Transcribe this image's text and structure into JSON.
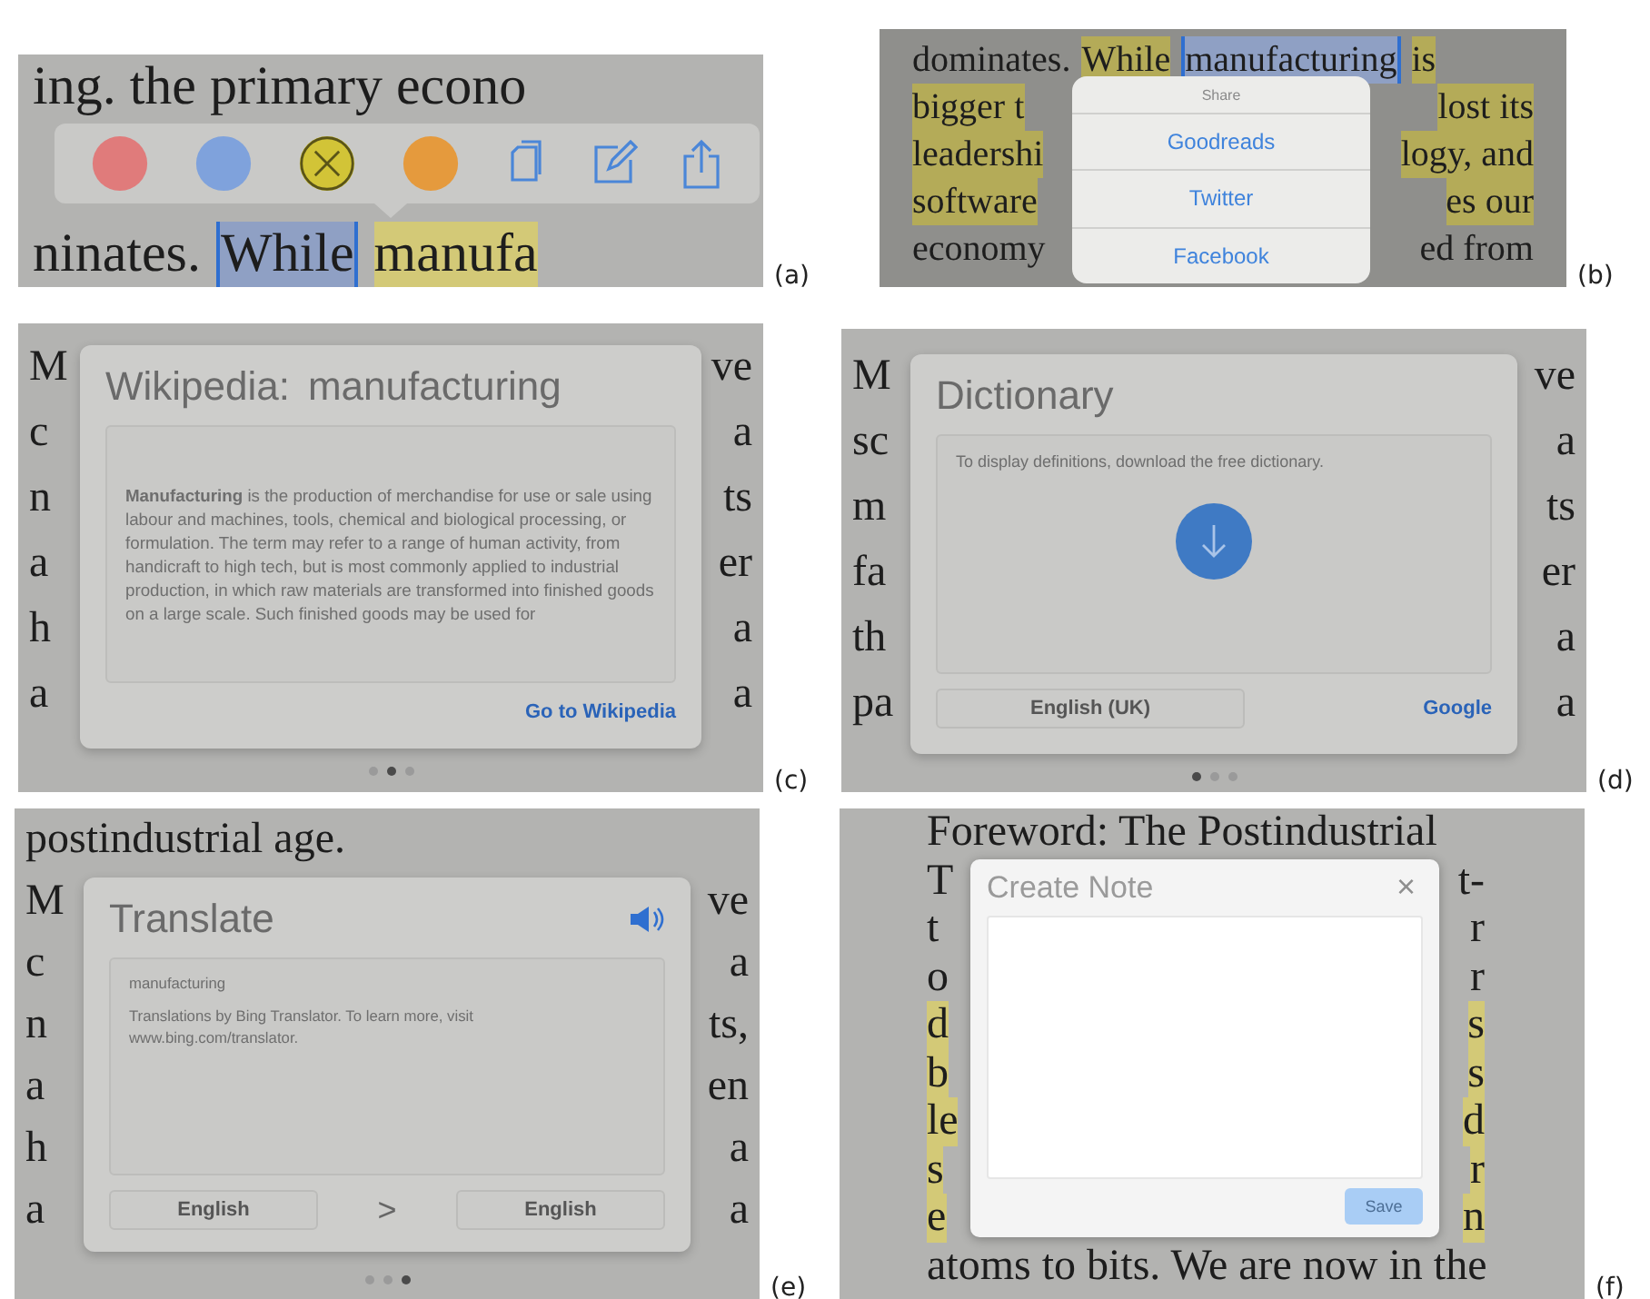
{
  "panels": [
    {
      "label": "(a)",
      "kind": "toolbar",
      "page_lines": [
        {
          "segments": [
            {
              "text": "ing. the primary econo",
              "highlighted": false,
              "selected": false
            }
          ]
        },
        {
          "segments": [
            {
              "text": "ninates.",
              "highlighted": false,
              "selected": false
            },
            {
              "text": "While",
              "highlighted": false,
              "selected": true
            },
            {
              "text": "manufa",
              "highlighted": true,
              "selected": false
            }
          ]
        }
      ],
      "toolbar": {
        "colors": [
          {
            "color": "#e07b7b",
            "selected": false
          },
          {
            "color": "#7fa2dc",
            "selected": false
          },
          {
            "color": "#d2c437",
            "selected": true
          },
          {
            "color": "#e59a3d",
            "selected": false
          }
        ]
      }
    },
    {
      "label": "(b)",
      "kind": "share",
      "page_lines": [
        {
          "segments": [
            {
              "text": "dominates.",
              "highlighted": false,
              "selected": false
            },
            {
              "text": "While",
              "highlighted": true,
              "selected": false
            },
            {
              "text": "manufacturing",
              "highlighted": false,
              "selected": true
            },
            {
              "text": "is",
              "highlighted": true,
              "selected": false
            }
          ]
        },
        {
          "left": "bigger t",
          "right": "lost its",
          "highlighted": true
        },
        {
          "left": "leadershi",
          "right": "logy, and",
          "highlighted": true
        },
        {
          "left": "software",
          "right": "es our",
          "highlighted": true
        },
        {
          "left": "economy",
          "right": "ed from",
          "highlighted": false
        }
      ],
      "share": {
        "title": "Share",
        "items": [
          "Goodreads",
          "Twitter",
          "Facebook"
        ]
      }
    },
    {
      "label": "(c)",
      "kind": "wikipedia",
      "page_lines": [
        {
          "left": "M",
          "right": "ve",
          "highlighted": false
        },
        {
          "left": "c",
          "right": "a",
          "highlighted": false
        },
        {
          "left": "n",
          "right": "ts",
          "highlighted": false
        },
        {
          "left": "a",
          "right": "er",
          "highlighted": false
        },
        {
          "left": "h",
          "right": "a",
          "highlighted": false
        },
        {
          "left": "a",
          "right": "a",
          "highlighted": false
        }
      ],
      "card": {
        "title": "Wikipedia:",
        "term": "manufacturing",
        "body": "**Manufacturing** is the production of merchandise for use or sale using labour and machines, tools, chemical and biological processing, or formulation. The term may refer to a range of human activity, from handicraft to high tech, but is most commonly applied to industrial production, in which raw materials are transformed into finished goods on a large scale. Such finished goods may be used for",
        "link": "Go to Wikipedia"
      },
      "dots": [
        {
          "selected": false
        },
        {
          "selected": true
        },
        {
          "selected": false
        }
      ]
    },
    {
      "label": "(d)",
      "kind": "dictionary",
      "page_lines": [
        {
          "left": "M",
          "right": "ve",
          "highlighted": false
        },
        {
          "left": "sc",
          "right": "a",
          "highlighted": false
        },
        {
          "left": "m",
          "right": "ts",
          "highlighted": false
        },
        {
          "left": "fa",
          "right": "er",
          "highlighted": false
        },
        {
          "left": "th",
          "right": "a",
          "highlighted": false
        },
        {
          "left": "pa",
          "right": "a",
          "highlighted": false
        }
      ],
      "card": {
        "title": "Dictionary",
        "message": "To display definitions, download the free dictionary.",
        "language": "English (UK)",
        "link": "Google"
      },
      "dots": [
        {
          "selected": true
        },
        {
          "selected": false
        },
        {
          "selected": false
        }
      ]
    },
    {
      "label": "(e)",
      "kind": "translate",
      "page_lines": [
        {
          "left": "postindustrial age.",
          "highlighted": false
        },
        {
          "left": "M",
          "right": "ve",
          "highlighted": false
        },
        {
          "left": "c",
          "right": "a",
          "highlighted": false
        },
        {
          "left": "n",
          "right": "ts,",
          "highlighted": false
        },
        {
          "left": "a",
          "right": "en",
          "highlighted": false
        },
        {
          "left": "h",
          "right": "a",
          "highlighted": false
        },
        {
          "left": "a",
          "right": "a",
          "highlighted": false
        }
      ],
      "card": {
        "title": "Translate",
        "word": "manufacturing",
        "attribution": "Translations by Bing Translator. To learn more, visit www.bing.com/translator.",
        "from": "English",
        "arrow": ">",
        "to": "English"
      },
      "dots": [
        {
          "selected": false
        },
        {
          "selected": false
        },
        {
          "selected": true
        }
      ]
    },
    {
      "label": "(f)",
      "kind": "note",
      "page_lines": [
        {
          "left": "Foreword: The Postindustrial",
          "highlighted": false
        },
        {
          "left": "T",
          "right": "t-",
          "highlighted": false
        },
        {
          "left": "t",
          "right": "r",
          "highlighted": false
        },
        {
          "left": "o",
          "right": "r",
          "highlighted": false
        },
        {
          "left": "d",
          "right": "s",
          "highlighted": true
        },
        {
          "left": "b",
          "right": "s",
          "highlighted": true
        },
        {
          "left": "le",
          "right": "d",
          "highlighted": true
        },
        {
          "left": "s",
          "right": "r",
          "highlighted": true
        },
        {
          "left": "e",
          "right": "n",
          "highlighted": true
        },
        {
          "left": "atoms to bits. We are now in the",
          "highlighted": false
        }
      ],
      "note": {
        "title": "Create Note",
        "close": "×",
        "save": "Save",
        "save_disabled": true
      }
    }
  ]
}
